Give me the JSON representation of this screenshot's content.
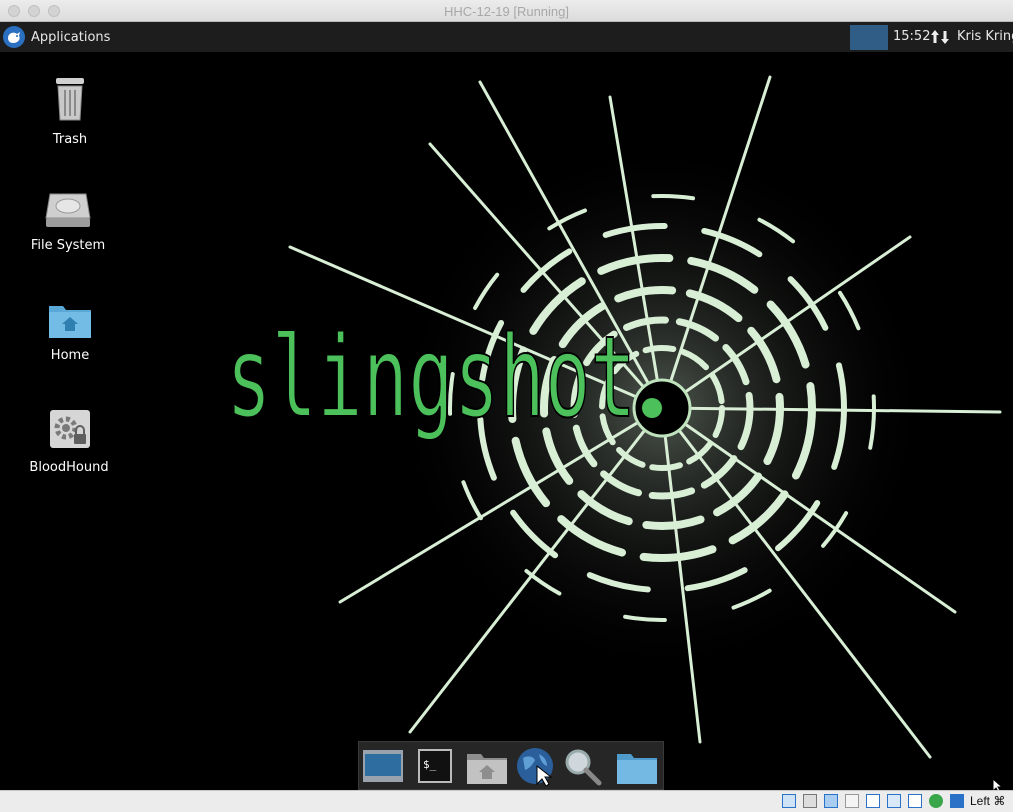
{
  "window": {
    "title": "HHC-12-19 [Running]"
  },
  "panel": {
    "applications_label": "Applications",
    "clock": "15:52",
    "user": "Kris Kringl"
  },
  "desktop_icons": [
    {
      "label": "Trash",
      "icon": "trash-icon"
    },
    {
      "label": "File System",
      "icon": "hard-drive-icon"
    },
    {
      "label": "Home",
      "icon": "home-folder-icon"
    },
    {
      "label": "BloodHound",
      "icon": "bloodhound-launcher-icon"
    }
  ],
  "wallpaper": {
    "text": "slingshot",
    "text_color": "#4cc05a"
  },
  "dock": [
    {
      "name": "show-desktop",
      "icon": "show-desktop-icon"
    },
    {
      "name": "terminal",
      "icon": "terminal-icon",
      "glyph": "$_"
    },
    {
      "name": "home-folder",
      "icon": "home-folder-icon"
    },
    {
      "name": "web-browser",
      "icon": "globe-icon"
    },
    {
      "name": "app-finder",
      "icon": "magnifier-icon"
    },
    {
      "name": "file-manager",
      "icon": "folder-icon"
    }
  ],
  "statusbar": {
    "host_key": "Left ⌘"
  },
  "colors": {
    "panel_bg": "#1d1d1d",
    "workspace_active": "#2f5d86",
    "accent_green": "#4cc05a"
  }
}
